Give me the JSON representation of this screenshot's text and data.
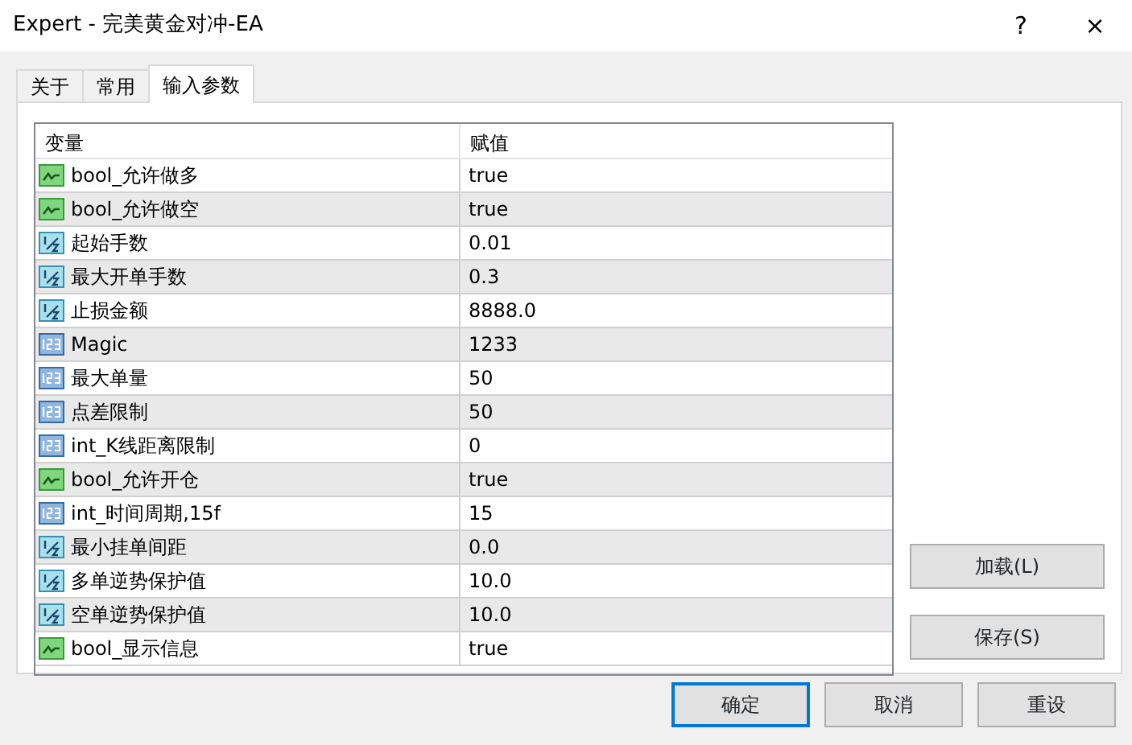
{
  "window": {
    "title": "Expert - 完美黄金对冲-EA",
    "help": "?",
    "close": "×"
  },
  "tabs": [
    {
      "label": "关于",
      "selected": false
    },
    {
      "label": "常用",
      "selected": false
    },
    {
      "label": "输入参数",
      "selected": true
    }
  ],
  "table": {
    "columns": [
      "变量",
      "赋值"
    ],
    "rows": [
      {
        "kind": "bool",
        "name": "bool_允许做多",
        "value": "true"
      },
      {
        "kind": "bool",
        "name": "bool_允许做空",
        "value": "true"
      },
      {
        "kind": "double",
        "name": "起始手数",
        "value": "0.01"
      },
      {
        "kind": "double",
        "name": "最大开单手数",
        "value": "0.3"
      },
      {
        "kind": "double",
        "name": "止损金额",
        "value": "8888.0"
      },
      {
        "kind": "int",
        "name": "Magic",
        "value": "1233"
      },
      {
        "kind": "int",
        "name": "最大单量",
        "value": "50"
      },
      {
        "kind": "int",
        "name": "点差限制",
        "value": "50"
      },
      {
        "kind": "int",
        "name": "int_K线距离限制",
        "value": "0"
      },
      {
        "kind": "bool",
        "name": "bool_允许开仓",
        "value": "true"
      },
      {
        "kind": "int",
        "name": "int_时间周期,15f",
        "value": "15"
      },
      {
        "kind": "double",
        "name": "最小挂单间距",
        "value": "0.0"
      },
      {
        "kind": "double",
        "name": "多单逆势保护值",
        "value": "10.0"
      },
      {
        "kind": "double",
        "name": "空单逆势保护值",
        "value": "10.0"
      },
      {
        "kind": "bool",
        "name": "bool_显示信息",
        "value": "true"
      }
    ]
  },
  "side_buttons": [
    "加载(L)",
    "保存(S)"
  ],
  "buttons": [
    {
      "label": "确定",
      "focused": true
    },
    {
      "label": "取消",
      "focused": false
    },
    {
      "label": "重设",
      "focused": false
    }
  ]
}
